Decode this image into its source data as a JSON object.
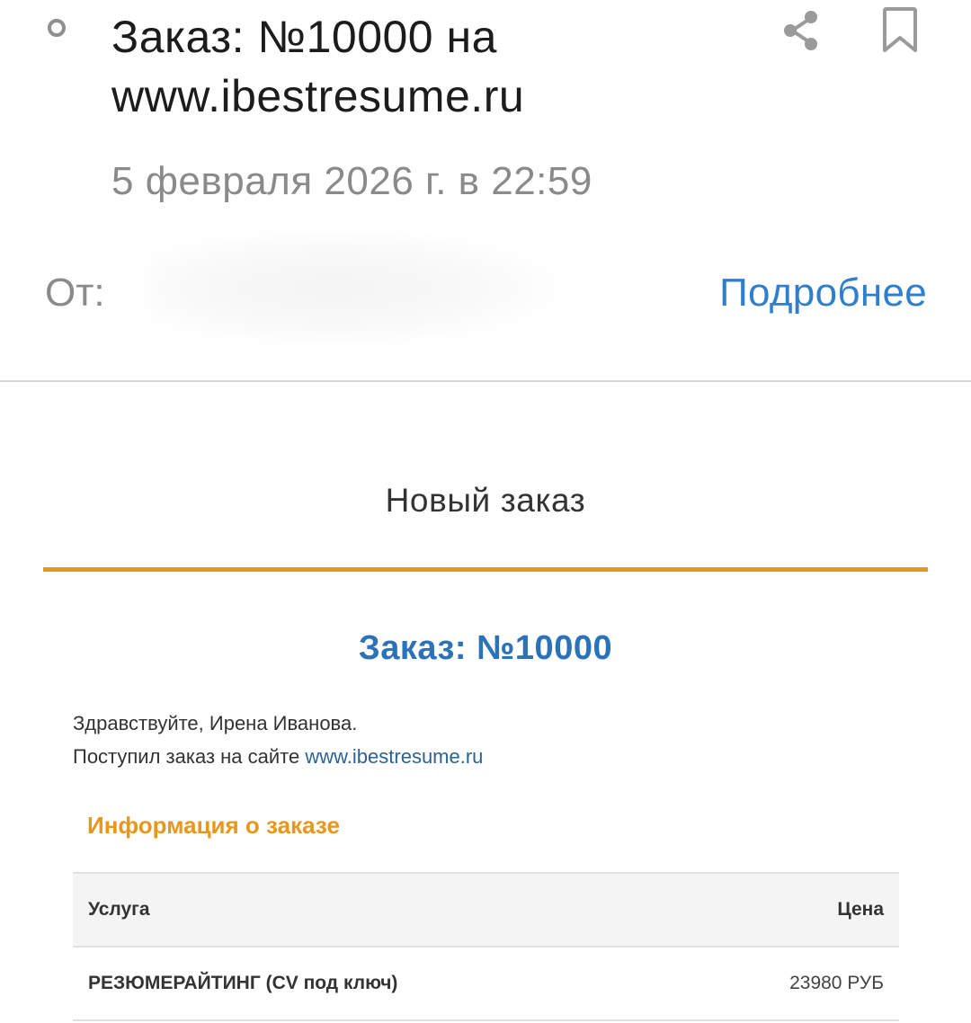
{
  "header": {
    "subject": "Заказ: №10000 на www.ibestresume.ru",
    "date": "5 февраля 2026 г. в 22:59",
    "from_label": "От:",
    "more_link": "Подробнее",
    "icons": [
      "unread-dot-icon",
      "share-icon",
      "bookmark-icon"
    ]
  },
  "email": {
    "heading": "Новый заказ",
    "order_title": "Заказ: №10000",
    "greeting": "Здравствуйте, Ирена Иванова.",
    "notice_text": "Поступил заказ на сайте ",
    "notice_link": "www.ibestresume.ru",
    "section_title": "Информация о заказе",
    "table": {
      "headers": {
        "service": "Услуга",
        "price": "Цена"
      },
      "rows": [
        {
          "service": "РЕЗЮМЕРАЙТИНГ (CV под ключ)",
          "price": "23980 РУБ"
        }
      ]
    }
  },
  "colors": {
    "accent": "#e8961c",
    "link": "#2f7fcc",
    "order_title": "#2b72b8",
    "muted_text": "#8a8a8a"
  }
}
